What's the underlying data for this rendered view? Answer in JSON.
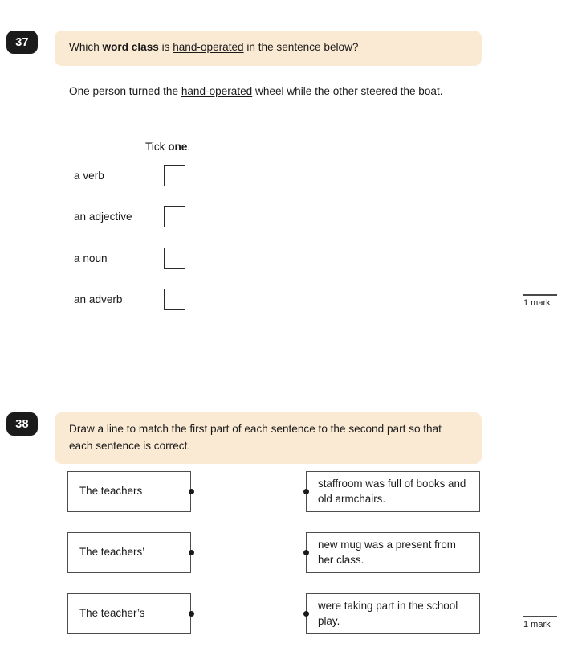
{
  "page": {
    "background": "#ffffff",
    "badge_color": "#1b1b1b",
    "banner_color": "#fbead3"
  },
  "questions": [
    {
      "number": "37",
      "prompt_parts": {
        "before_bold": "Which ",
        "bold": "word class",
        "middle": " is ",
        "underlined": "hand-operated",
        "after": " in the sentence below?"
      },
      "sentence_parts": {
        "before": "One person turned the ",
        "underlined": "hand-operated",
        "after": " wheel while the other steered the boat."
      },
      "instruction": {
        "before_bold": "Tick ",
        "bold": "one",
        "after": "."
      },
      "options": [
        {
          "label": "a verb"
        },
        {
          "label": "an adjective"
        },
        {
          "label": "a noun"
        },
        {
          "label": "an adverb"
        }
      ],
      "mark": "1 mark"
    },
    {
      "number": "38",
      "prompt": "Draw a line to match the first part of each sentence to the second part so that each sentence is correct.",
      "left_items": [
        {
          "text": "The teachers"
        },
        {
          "text": "The teachers’"
        },
        {
          "text": "The teacher’s"
        }
      ],
      "right_items": [
        {
          "text": "staffroom was full of books and old armchairs."
        },
        {
          "text": "new mug was a present from her class."
        },
        {
          "text": "were taking part in the school play."
        }
      ],
      "mark": "1 mark"
    }
  ]
}
